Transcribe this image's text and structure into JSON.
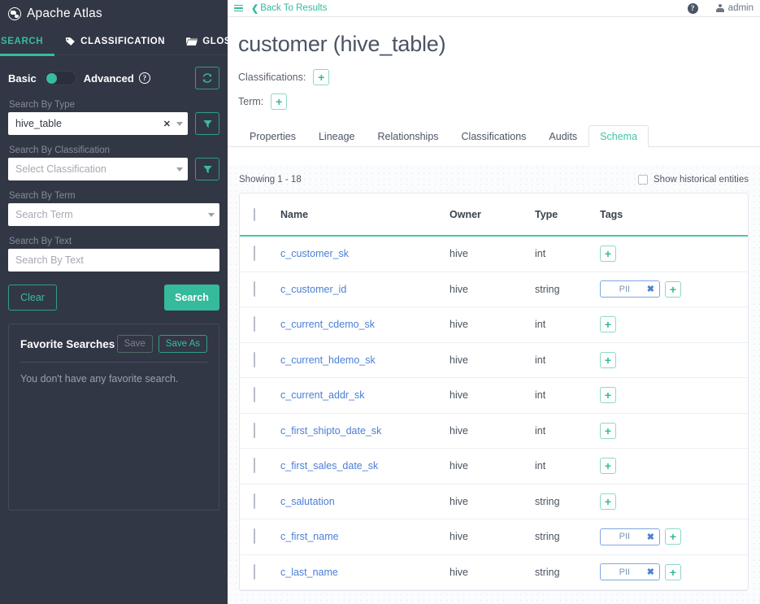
{
  "sidebar": {
    "brand": {
      "logo_icon": "globe-icon",
      "title": "Apache Atlas"
    },
    "nav_tabs": [
      {
        "label": "SEARCH",
        "icon": "search-icon",
        "active": true
      },
      {
        "label": "CLASSIFICATION",
        "icon": "tag-icon",
        "active": false
      },
      {
        "label": "GLOSSARY",
        "icon": "folder-icon",
        "active": false
      }
    ],
    "mode": {
      "basic_label": "Basic",
      "advanced_label": "Advanced",
      "help_icon": "question-mark-icon",
      "toggle_state": "basic",
      "refresh_icon": "refresh-icon"
    },
    "search_by_type": {
      "label": "Search By Type",
      "value": "hive_table",
      "clear_icon": "clear-x-icon",
      "caret_icon": "chevron-down-icon",
      "filter_icon": "filter-icon"
    },
    "search_by_classification": {
      "label": "Search By Classification",
      "placeholder": "Select Classification",
      "caret_icon": "chevron-down-icon",
      "filter_icon": "filter-icon"
    },
    "search_by_term": {
      "label": "Search By Term",
      "placeholder": "Search Term",
      "caret_icon": "chevron-down-icon"
    },
    "search_by_text": {
      "label": "Search By Text",
      "placeholder": "Search By Text",
      "value": ""
    },
    "actions": {
      "clear_label": "Clear",
      "search_label": "Search"
    },
    "favorites": {
      "title": "Favorite Searches",
      "save_label": "Save",
      "save_as_label": "Save As",
      "empty_text": "You don't have any favorite search."
    },
    "colors": {
      "accent": "#38bc9d",
      "background": "#323745"
    }
  },
  "topbar": {
    "menu_icon": "hamburger-icon",
    "back_label": "Back To Results",
    "back_chevron": "chevron-left-icon",
    "help_icon": "question-mark-icon",
    "user_icon": "user-icon",
    "user_name": "admin"
  },
  "entity": {
    "title": "customer (hive_table)",
    "classifications_label": "Classifications:",
    "classifications_add_icon": "plus-icon",
    "term_label": "Term:",
    "term_add_icon": "plus-icon"
  },
  "tabs": [
    {
      "label": "Properties",
      "active": false
    },
    {
      "label": "Lineage",
      "active": false
    },
    {
      "label": "Relationships",
      "active": false
    },
    {
      "label": "Classifications",
      "active": false
    },
    {
      "label": "Audits",
      "active": false
    },
    {
      "label": "Schema",
      "active": true
    }
  ],
  "schema": {
    "showing_text": "Showing 1 - 18",
    "historical_label": "Show historical entities",
    "historical_checked": false,
    "select_all_checked": false,
    "columns": [
      "",
      "Name",
      "Owner",
      "Type",
      "Tags"
    ],
    "add_tag_icon": "plus-icon",
    "tag_remove_icon": "close-x-icon",
    "rows": [
      {
        "name": "c_customer_sk",
        "owner": "hive",
        "type": "int",
        "tags": []
      },
      {
        "name": "c_customer_id",
        "owner": "hive",
        "type": "string",
        "tags": [
          "PII"
        ]
      },
      {
        "name": "c_current_cdemo_sk",
        "owner": "hive",
        "type": "int",
        "tags": []
      },
      {
        "name": "c_current_hdemo_sk",
        "owner": "hive",
        "type": "int",
        "tags": []
      },
      {
        "name": "c_current_addr_sk",
        "owner": "hive",
        "type": "int",
        "tags": []
      },
      {
        "name": "c_first_shipto_date_sk",
        "owner": "hive",
        "type": "int",
        "tags": []
      },
      {
        "name": "c_first_sales_date_sk",
        "owner": "hive",
        "type": "int",
        "tags": []
      },
      {
        "name": "c_salutation",
        "owner": "hive",
        "type": "string",
        "tags": []
      },
      {
        "name": "c_first_name",
        "owner": "hive",
        "type": "string",
        "tags": [
          "PII"
        ]
      },
      {
        "name": "c_last_name",
        "owner": "hive",
        "type": "string",
        "tags": [
          "PII"
        ]
      }
    ]
  },
  "colors": {
    "accent_green": "#35ba9b",
    "link_blue": "#4a7fd4",
    "tag_border": "#7fa8e0"
  }
}
